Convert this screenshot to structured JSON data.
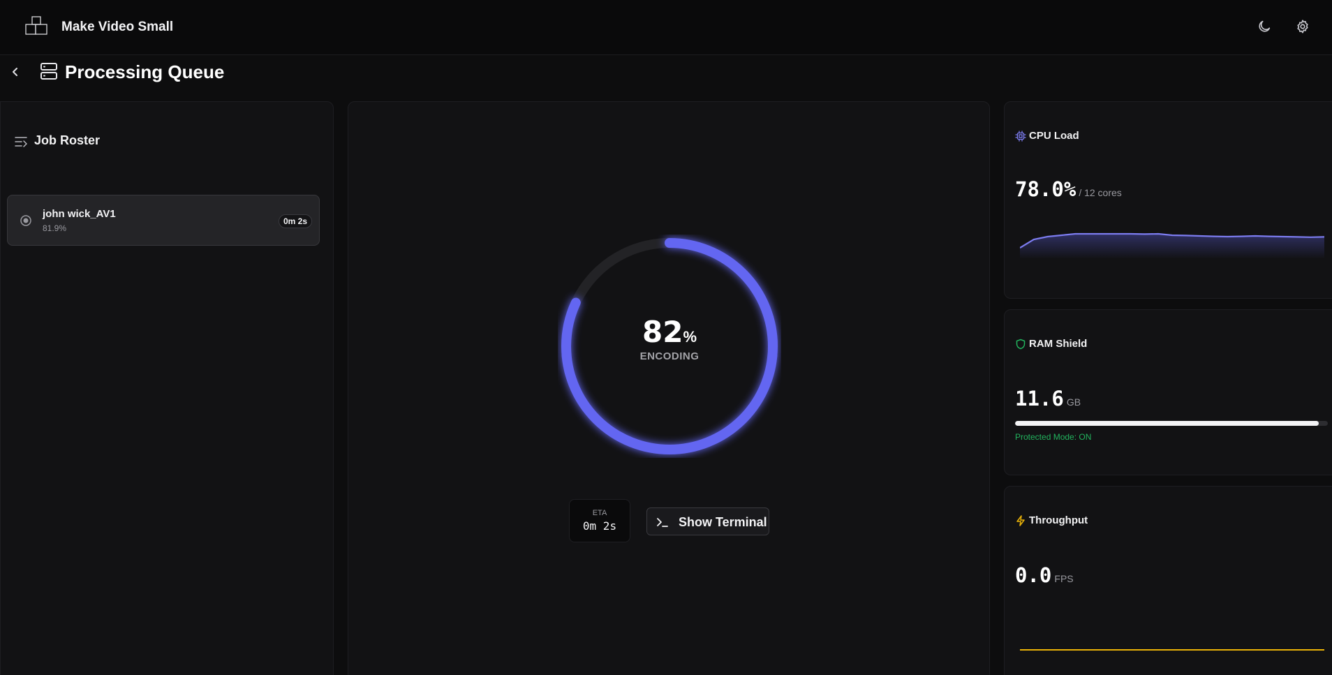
{
  "app": {
    "title": "Make Video Small"
  },
  "page": {
    "title": "Processing Queue"
  },
  "roster": {
    "title": "Job Roster",
    "jobs": [
      {
        "name": "john wick_AV1",
        "progress": "81.9%",
        "elapsed": "0m 2s"
      }
    ]
  },
  "progress": {
    "percent_value": "82",
    "percent_sign": "%",
    "fraction": 0.819,
    "status": "ENCODING",
    "eta_label": "ETA",
    "eta_value": "0m 2s",
    "terminal_button": "Show Terminal",
    "colors": {
      "ring": "#6366f1",
      "track": "#232326"
    }
  },
  "metrics": {
    "cpu": {
      "title": "CPU Load",
      "value": "78.0%",
      "unit": "/ 12 cores",
      "icon": "cpu-icon",
      "color": "#7c7cf0",
      "history": [
        68,
        74,
        76,
        77,
        78,
        78,
        78,
        78,
        78,
        77.8,
        78,
        77,
        76.8,
        76.5,
        76.2,
        76,
        76.2,
        76.5,
        76.2,
        76,
        75.8,
        75.6,
        75.8
      ]
    },
    "ram": {
      "title": "RAM Shield",
      "value": "11.6",
      "unit": "GB",
      "icon": "shield-icon",
      "color": "#22b45e",
      "fill": 0.97,
      "status": "Protected Mode: ON"
    },
    "throughput": {
      "title": "Throughput",
      "value": "0.0",
      "unit": "FPS",
      "icon": "lightning-icon",
      "color": "#eab308"
    }
  }
}
